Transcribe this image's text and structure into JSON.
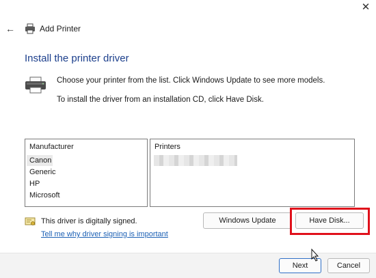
{
  "window": {
    "title": "Add Printer",
    "close_glyph": "✕",
    "back_glyph": "←"
  },
  "page": {
    "heading": "Install the printer driver",
    "description_1": "Choose your printer from the list. Click Windows Update to see more models.",
    "description_2": "To install the driver from an installation CD, click Have Disk."
  },
  "manufacturer_list": {
    "header": "Manufacturer",
    "items": [
      "Canon",
      "Generic",
      "HP",
      "Microsoft"
    ],
    "selected": "Canon"
  },
  "printers_list": {
    "header": "Printers"
  },
  "signing": {
    "status": "This driver is digitally signed.",
    "link": "Tell me why driver signing is important"
  },
  "buttons": {
    "windows_update": "Windows Update",
    "have_disk": "Have Disk...",
    "next": "Next",
    "cancel": "Cancel"
  },
  "colors": {
    "heading": "#1c3f8c",
    "link": "#1a5fb4",
    "highlight": "#e0101b",
    "default_button_border": "#2f6fc7"
  }
}
